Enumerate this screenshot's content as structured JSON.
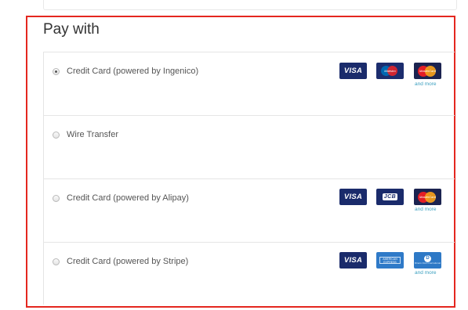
{
  "heading": "Pay with",
  "methods": [
    {
      "label": "Credit Card (powered by Ingenico)",
      "selected": true,
      "logos": [
        "visa-logo",
        "maestro-logo",
        "mastercard-logo"
      ],
      "more_label": "and more"
    },
    {
      "label": "Wire Transfer",
      "selected": false,
      "logos": []
    },
    {
      "label": "Credit Card (powered by Alipay)",
      "selected": false,
      "logos": [
        "visa-logo",
        "jcb-logo",
        "mastercard-logo"
      ],
      "more_label": "and more"
    },
    {
      "label": "Credit Card (powered by Stripe)",
      "selected": false,
      "logos": [
        "visa-logo",
        "amex-logo",
        "diners-club-logo"
      ],
      "more_label": "and more"
    }
  ],
  "logo_text": {
    "visa": "VISA",
    "maestro": "Maestro",
    "mastercard": "MasterCard",
    "jcb": "JCB",
    "amex": "AMERICAN EXPRESS",
    "diners_mark": "D",
    "diners": "Diners Club International"
  },
  "colors": {
    "highlight_border": "#e4271f",
    "card_navy": "#1a2b6b",
    "and_more_link": "#3a9fbf"
  }
}
